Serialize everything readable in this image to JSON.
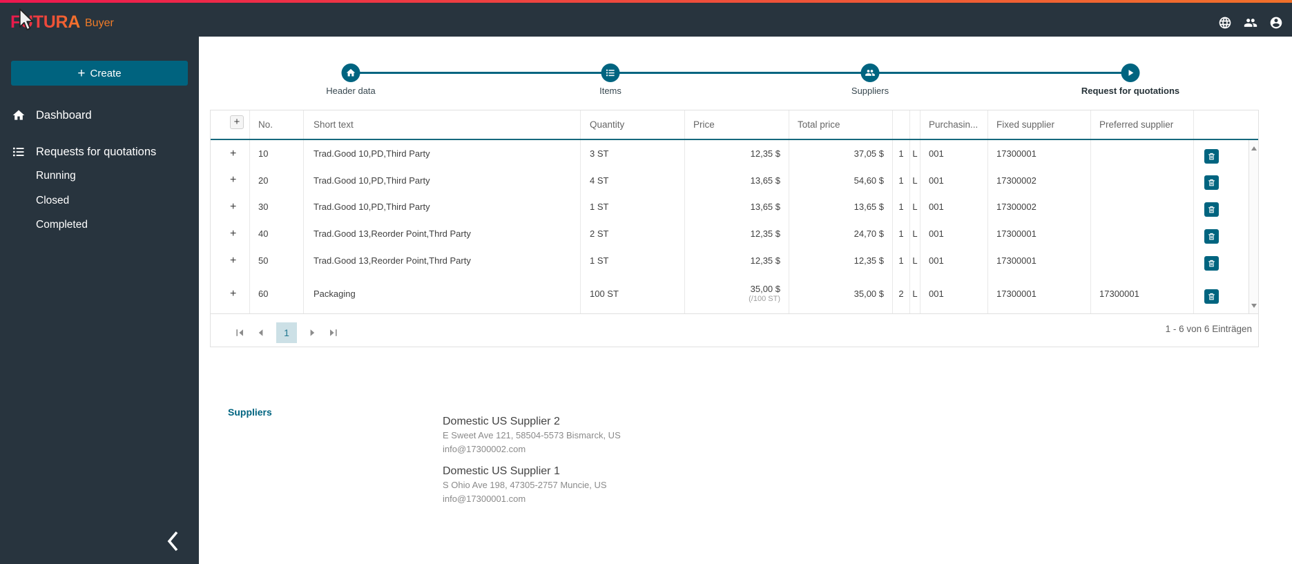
{
  "brand": {
    "logo": "FUTURA",
    "product": "Buyer"
  },
  "topbar": {
    "icons": [
      "language-icon",
      "users-icon",
      "account-icon"
    ]
  },
  "sidebar": {
    "create_label": "Create",
    "items": [
      {
        "label": "Dashboard",
        "icon": "home"
      },
      {
        "label": "Requests for quotations",
        "icon": "list"
      }
    ],
    "subitems": [
      "Running",
      "Closed",
      "Completed"
    ]
  },
  "stepper": {
    "steps": [
      {
        "label": "Header data",
        "icon": "home",
        "active": false
      },
      {
        "label": "Items",
        "icon": "list",
        "active": false
      },
      {
        "label": "Suppliers",
        "icon": "people",
        "active": false
      },
      {
        "label": "Request for quotations",
        "icon": "play",
        "active": true
      }
    ]
  },
  "table": {
    "headers": {
      "expand": "+",
      "no": "No.",
      "short_text": "Short text",
      "quantity": "Quantity",
      "price": "Price",
      "total_price": "Total price",
      "purchasing": "Purchasin...",
      "fixed_supplier": "Fixed supplier",
      "preferred_supplier": "Preferred supplier"
    },
    "rows": [
      {
        "no": "10",
        "short_text": "Trad.Good 10,PD,Third Party",
        "quantity": "3 ST",
        "price": "12,35 $",
        "price_unit": "",
        "total": "37,05 $",
        "c1": "1",
        "c2": "L",
        "purchasing": "001",
        "fixed": "17300001",
        "preferred": ""
      },
      {
        "no": "20",
        "short_text": "Trad.Good 10,PD,Third Party",
        "quantity": "4 ST",
        "price": "13,65 $",
        "price_unit": "",
        "total": "54,60 $",
        "c1": "1",
        "c2": "L",
        "purchasing": "001",
        "fixed": "17300002",
        "preferred": ""
      },
      {
        "no": "30",
        "short_text": "Trad.Good 10,PD,Third Party",
        "quantity": "1 ST",
        "price": "13,65 $",
        "price_unit": "",
        "total": "13,65 $",
        "c1": "1",
        "c2": "L",
        "purchasing": "001",
        "fixed": "17300002",
        "preferred": ""
      },
      {
        "no": "40",
        "short_text": "Trad.Good 13,Reorder Point,Thrd Party",
        "quantity": "2 ST",
        "price": "12,35 $",
        "price_unit": "",
        "total": "24,70 $",
        "c1": "1",
        "c2": "L",
        "purchasing": "001",
        "fixed": "17300001",
        "preferred": ""
      },
      {
        "no": "50",
        "short_text": "Trad.Good 13,Reorder Point,Thrd Party",
        "quantity": "1 ST",
        "price": "12,35 $",
        "price_unit": "",
        "total": "12,35 $",
        "c1": "1",
        "c2": "L",
        "purchasing": "001",
        "fixed": "17300001",
        "preferred": ""
      },
      {
        "no": "60",
        "short_text": "Packaging",
        "quantity": "100 ST",
        "price": "35,00 $",
        "price_unit": "(/100 ST)",
        "total": "35,00 $",
        "c1": "2",
        "c2": "L",
        "purchasing": "001",
        "fixed": "17300001",
        "preferred": "17300001"
      }
    ],
    "pagination": {
      "page": "1",
      "info": "1 - 6 von 6 Einträgen"
    }
  },
  "suppliers_section": {
    "title": "Suppliers",
    "entries": [
      {
        "name": "Domestic US Supplier 2",
        "address": "E Sweet Ave 121, 58504-5573 Bismarck, US",
        "email": "info@17300002.com"
      },
      {
        "name": "Domestic US Supplier 1",
        "address": "S Ohio Ave 198, 47305-2757 Muncie, US",
        "email": "info@17300001.com"
      }
    ]
  },
  "colors": {
    "accent_teal": "#00647f",
    "bar_bg": "#28343e",
    "strip_gradient_start": "#ed174f",
    "strip_gradient_end": "#f0702a",
    "page_current_bg": "#cce0e6"
  }
}
